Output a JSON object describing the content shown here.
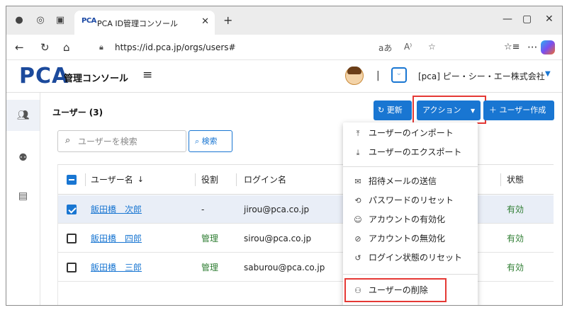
{
  "browser": {
    "tab_title": "PCA ID管理コンソール",
    "tab_favicon": "PCA",
    "url": "https://id.pca.jp/orgs/users#",
    "icons": [
      "profile-icon",
      "workspaces-icon",
      "tab-actions-icon",
      "close-icon",
      "new-tab-icon",
      "back-icon",
      "refresh-icon",
      "home-icon",
      "lock-icon",
      "read-aloud-icon",
      "immersive-reader-icon",
      "favorite-icon",
      "favorites-bar-icon",
      "more-icon",
      "copilot-icon"
    ]
  },
  "header": {
    "logo": "PCA",
    "console_title": "管理コンソール",
    "separator": "|",
    "org_name": "[pca] ピー・シー・エー株式会社"
  },
  "page": {
    "title": "ユーザー",
    "count": "(3)"
  },
  "toolbar": {
    "refresh_label": "更新",
    "action_label": "アクション",
    "create_label": "ユーザー作成",
    "search_placeholder": "ユーザーを検索",
    "search_button": "検索"
  },
  "table": {
    "columns": {
      "name": "ユーザー名",
      "role": "役割",
      "login": "ログイン名",
      "status": "状態"
    },
    "rows": [
      {
        "name": "飯田橋　次郎",
        "role": "-",
        "login": "jirou@pca.co.jp",
        "status": "有効",
        "selected": true
      },
      {
        "name": "飯田橋　四郎",
        "role": "管理",
        "login": "sirou@pca.co.jp",
        "status": "有効",
        "selected": false
      },
      {
        "name": "飯田橋　三郎",
        "role": "管理",
        "login": "saburou@pca.co.jp",
        "status": "有効",
        "selected": false
      }
    ]
  },
  "action_menu": {
    "items": [
      {
        "label": "ユーザーのインポート",
        "icon": "upload-icon"
      },
      {
        "label": "ユーザーのエクスポート",
        "icon": "download-icon"
      },
      {
        "label": "招待メールの送信",
        "icon": "mail-send-icon"
      },
      {
        "label": "パスワードのリセット",
        "icon": "password-reset-icon"
      },
      {
        "label": "アカウントの有効化",
        "icon": "account-enable-icon"
      },
      {
        "label": "アカウントの無効化",
        "icon": "account-disable-icon"
      },
      {
        "label": "ログイン状態のリセット",
        "icon": "login-reset-icon"
      },
      {
        "label": "ユーザーの削除",
        "icon": "user-remove-icon"
      }
    ]
  },
  "colors": {
    "brand": "#1c4a9c",
    "primary": "#1976d2",
    "success": "#2e7d32",
    "highlight": "#e53935",
    "selected_row": "#e9eef7"
  }
}
